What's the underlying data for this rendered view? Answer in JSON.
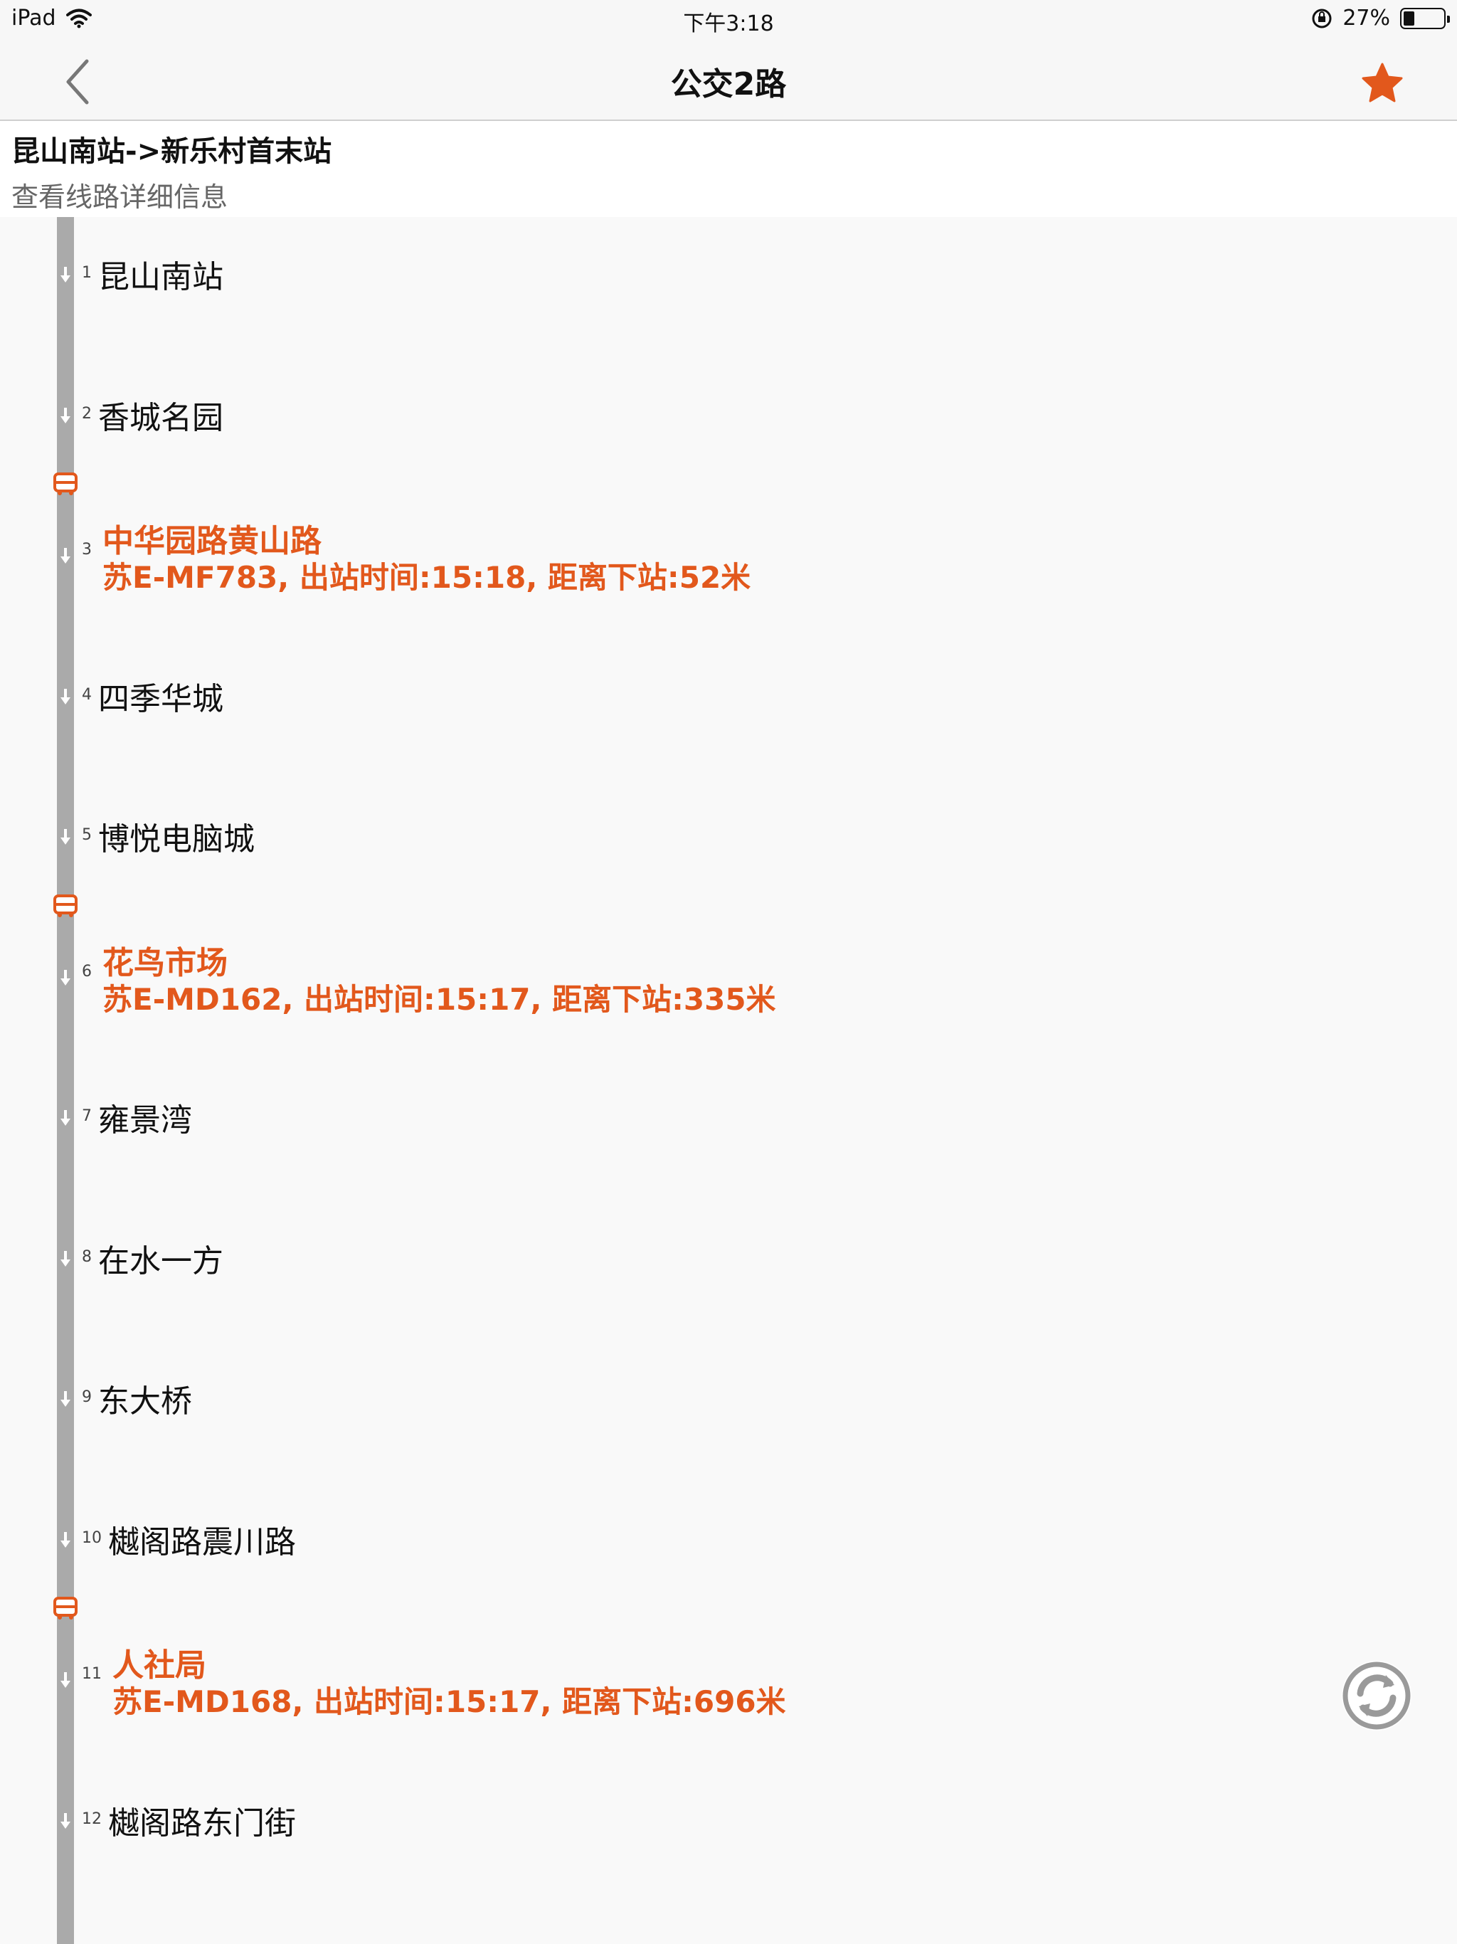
{
  "status_bar": {
    "device": "iPad",
    "time": "下午3:18",
    "battery_text": "27%",
    "battery_level": 0.27
  },
  "nav": {
    "title": "公交2路"
  },
  "route": {
    "name": "昆山南站->新乐村首末站",
    "detail_link": "查看线路详细信息"
  },
  "stops": [
    {
      "num": "1",
      "name": "昆山南站"
    },
    {
      "num": "2",
      "name": "香城名园"
    },
    {
      "num": "3",
      "name": "中华园路黄山路",
      "bus": "苏E-MF783, 出站时间:15:18, 距离下站:52米"
    },
    {
      "num": "4",
      "name": "四季华城"
    },
    {
      "num": "5",
      "name": "博悦电脑城"
    },
    {
      "num": "6",
      "name": "花鸟市场",
      "bus": "苏E-MD162, 出站时间:15:17, 距离下站:335米"
    },
    {
      "num": "7",
      "name": "雍景湾"
    },
    {
      "num": "8",
      "name": "在水一方"
    },
    {
      "num": "9",
      "name": "东大桥"
    },
    {
      "num": "10",
      "name": "樾阁路震川路"
    },
    {
      "num": "11",
      "name": "人社局",
      "bus": "苏E-MD168, 出站时间:15:17, 距离下站:696米"
    },
    {
      "num": "12",
      "name": "樾阁路东门街"
    }
  ],
  "colors": {
    "accent": "#e2581c",
    "timeline": "#aaaaaa"
  }
}
